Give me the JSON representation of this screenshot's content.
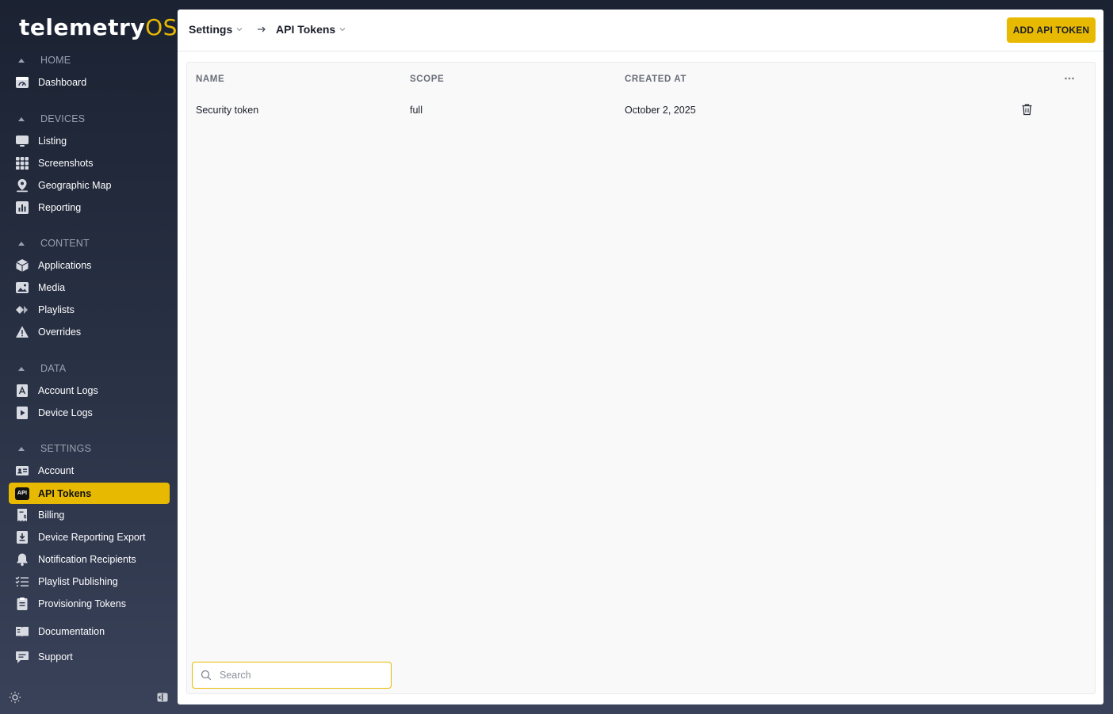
{
  "app": {
    "logo_main": "telemetry",
    "logo_suffix": "OS",
    "accent_color": "#e8b901"
  },
  "sidebar": {
    "sections": {
      "home": "HOME",
      "devices": "DEVICES",
      "content": "CONTENT",
      "data": "DATA",
      "settings": "SETTINGS"
    },
    "items": {
      "dashboard": "Dashboard",
      "listing": "Listing",
      "screenshots": "Screenshots",
      "geographic_map": "Geographic Map",
      "reporting": "Reporting",
      "applications": "Applications",
      "media": "Media",
      "playlists": "Playlists",
      "overrides": "Overrides",
      "account_logs": "Account Logs",
      "device_logs": "Device Logs",
      "account": "Account",
      "api_tokens": "API Tokens",
      "billing": "Billing",
      "device_reporting_export": "Device Reporting Export",
      "notification_recipients": "Notification Recipients",
      "playlist_publishing": "Playlist Publishing",
      "provisioning_tokens": "Provisioning Tokens",
      "documentation": "Documentation",
      "support": "Support"
    },
    "api_badge": "API",
    "active_item": "API Tokens"
  },
  "header": {
    "breadcrumb": [
      "Settings",
      "API Tokens"
    ],
    "add_button": "ADD API TOKEN"
  },
  "table": {
    "columns": [
      "NAME",
      "SCOPE",
      "CREATED AT"
    ],
    "rows": [
      {
        "name": "Security token",
        "scope": "full",
        "created_at": "October 2, 2025"
      }
    ]
  },
  "search": {
    "placeholder": "Search",
    "value": ""
  }
}
